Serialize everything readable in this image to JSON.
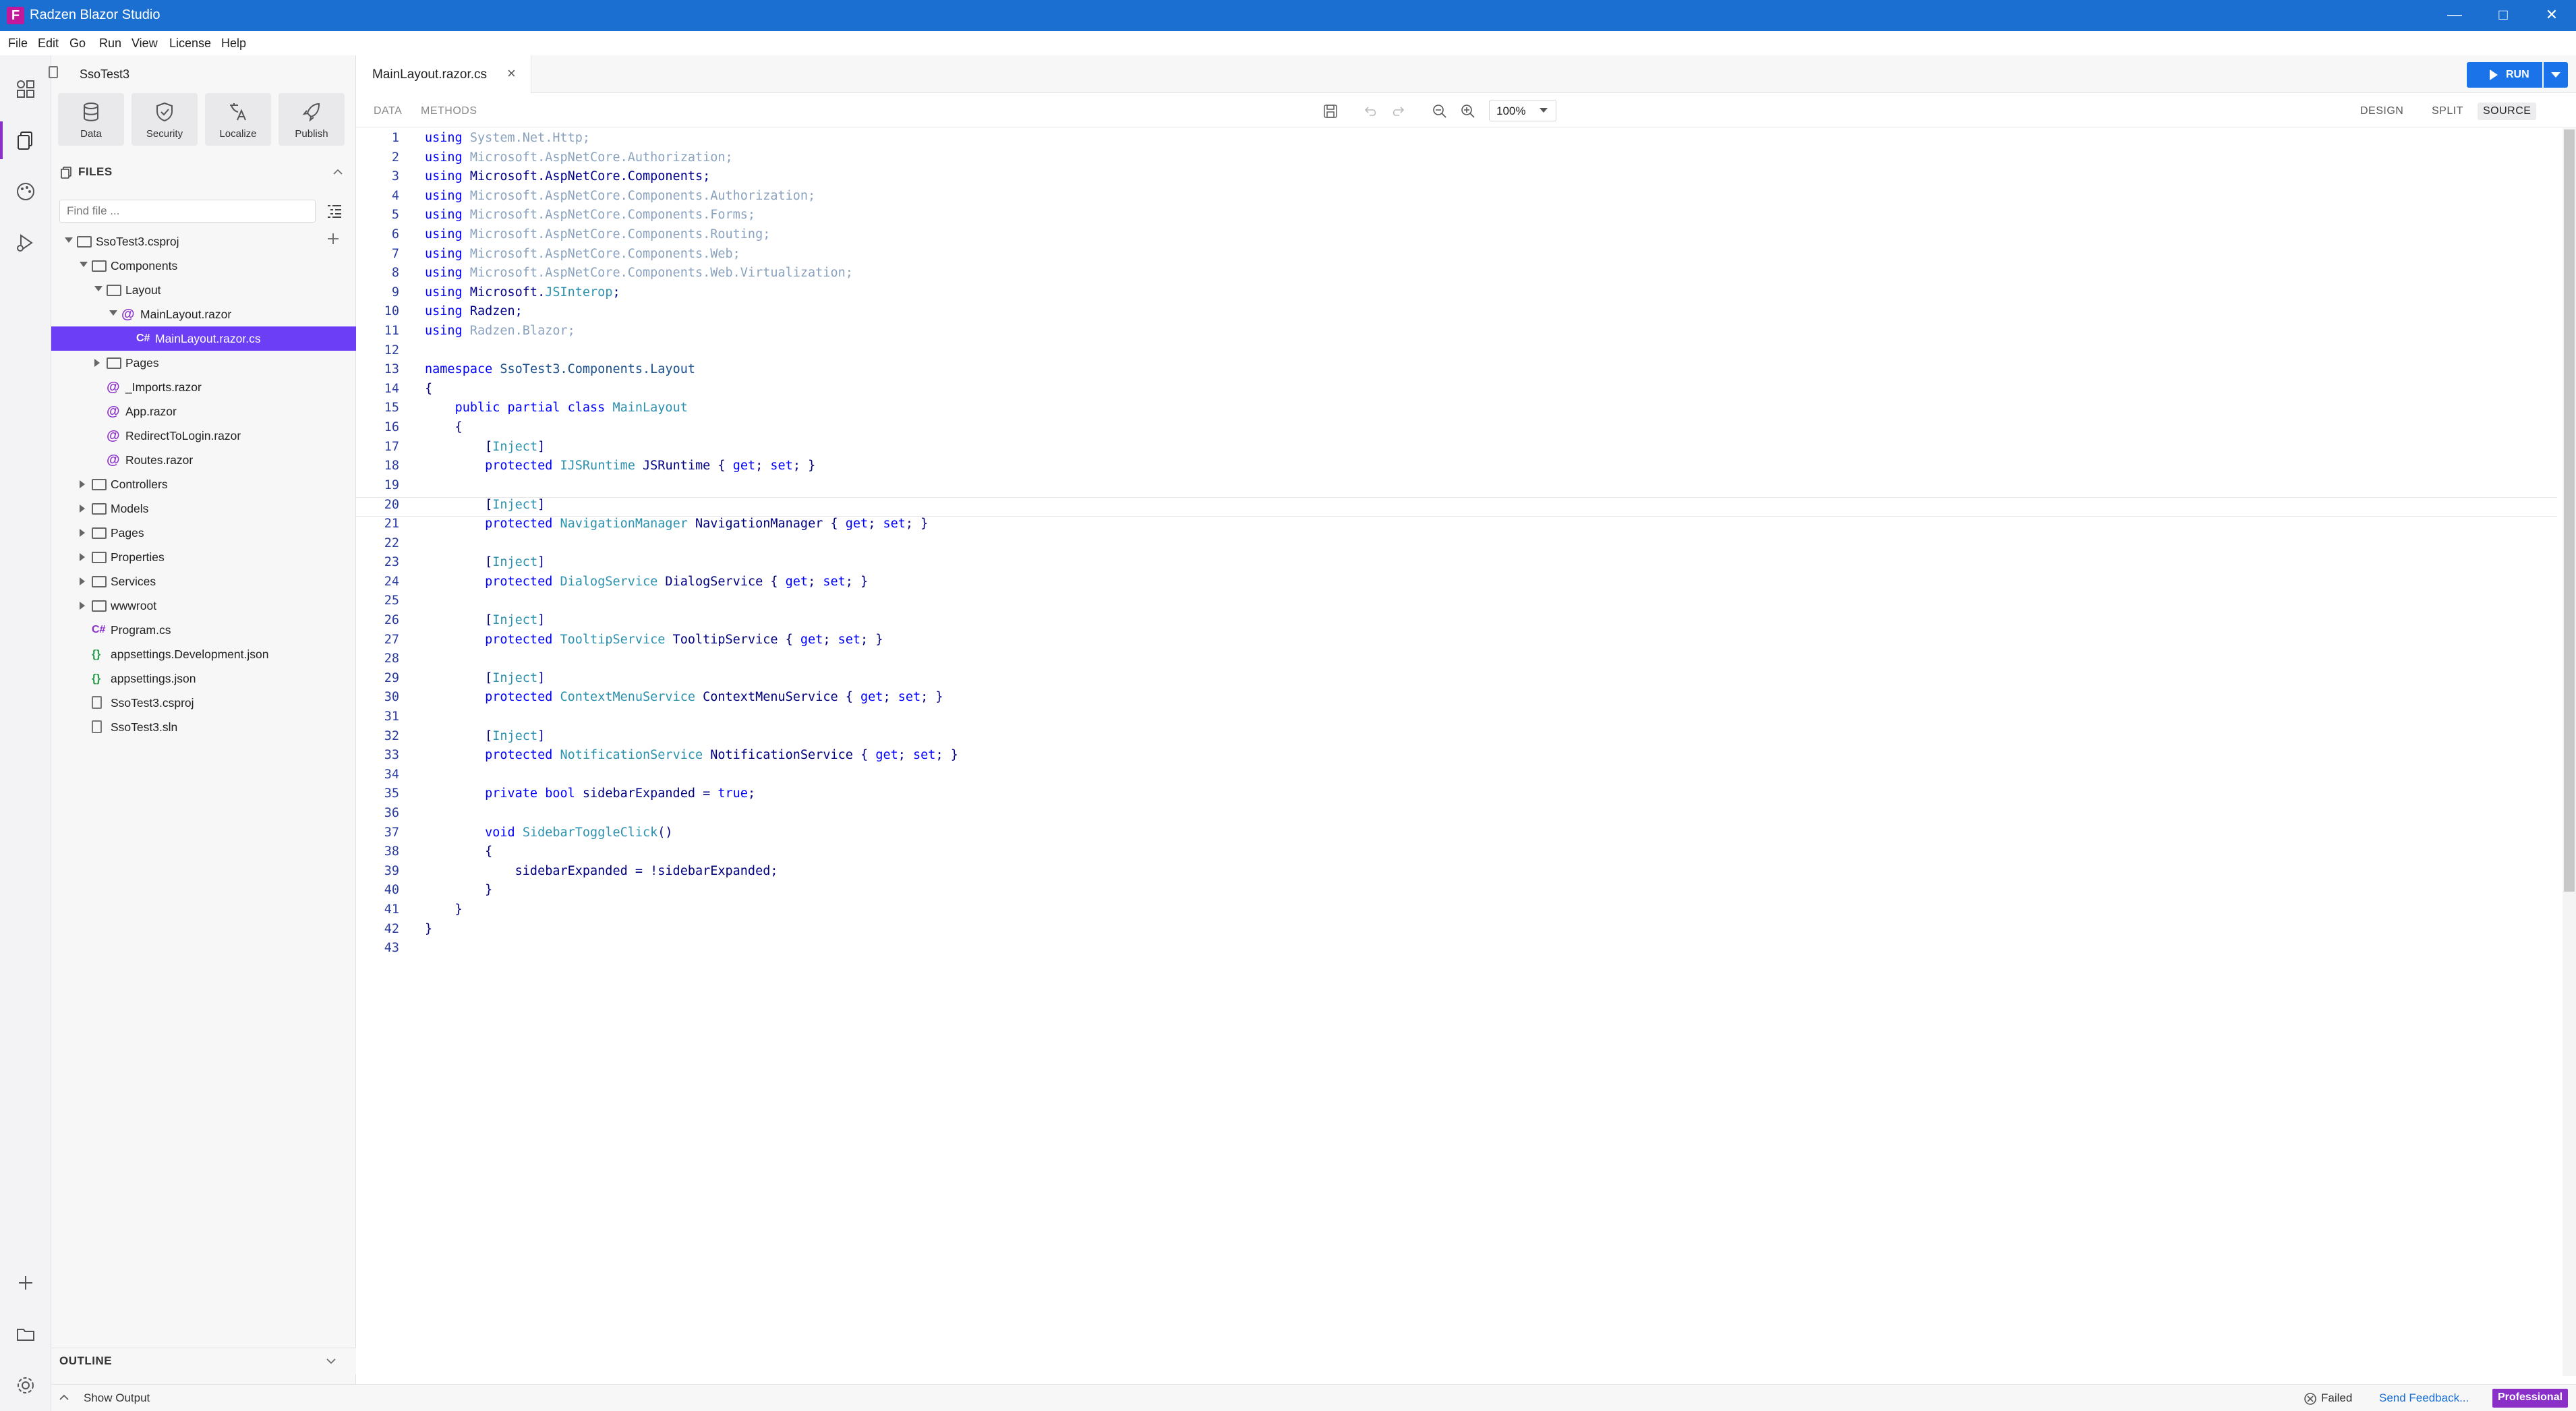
{
  "window": {
    "title": "Radzen Blazor Studio",
    "logo": "F"
  },
  "menu": [
    "File",
    "Edit",
    "Go",
    "Run",
    "View",
    "License",
    "Help"
  ],
  "activity_icons": [
    "components-icon",
    "files-icon",
    "theme-icon",
    "run-debug-icon",
    "add-icon",
    "folder-icon",
    "settings-icon"
  ],
  "sidebar": {
    "project": "SsoTest3",
    "tools": [
      {
        "label": "Data",
        "icon": "database-icon"
      },
      {
        "label": "Security",
        "icon": "shield-icon"
      },
      {
        "label": "Localize",
        "icon": "translate-icon"
      },
      {
        "label": "Publish",
        "icon": "rocket-icon"
      }
    ],
    "files_header": "FILES",
    "find_placeholder": "Find file ...",
    "tree": [
      {
        "name": "SsoTest3.csproj",
        "kind": "folder",
        "depth": 0,
        "arrow": "open"
      },
      {
        "name": "Components",
        "kind": "folder",
        "depth": 1,
        "arrow": "open"
      },
      {
        "name": "Layout",
        "kind": "folder",
        "depth": 2,
        "arrow": "open"
      },
      {
        "name": "MainLayout.razor",
        "kind": "razor",
        "depth": 3,
        "arrow": "open"
      },
      {
        "name": "MainLayout.razor.cs",
        "kind": "cs",
        "depth": 4,
        "arrow": "",
        "selected": true
      },
      {
        "name": "Pages",
        "kind": "folder",
        "depth": 2,
        "arrow": "closed"
      },
      {
        "name": "_Imports.razor",
        "kind": "razor",
        "depth": 2,
        "arrow": ""
      },
      {
        "name": "App.razor",
        "kind": "razor",
        "depth": 2,
        "arrow": ""
      },
      {
        "name": "RedirectToLogin.razor",
        "kind": "razor",
        "depth": 2,
        "arrow": ""
      },
      {
        "name": "Routes.razor",
        "kind": "razor",
        "depth": 2,
        "arrow": ""
      },
      {
        "name": "Controllers",
        "kind": "folder",
        "depth": 1,
        "arrow": "closed"
      },
      {
        "name": "Models",
        "kind": "folder",
        "depth": 1,
        "arrow": "closed"
      },
      {
        "name": "Pages",
        "kind": "folder",
        "depth": 1,
        "arrow": "closed"
      },
      {
        "name": "Properties",
        "kind": "folder",
        "depth": 1,
        "arrow": "closed"
      },
      {
        "name": "Services",
        "kind": "folder",
        "depth": 1,
        "arrow": "closed"
      },
      {
        "name": "wwwroot",
        "kind": "folder",
        "depth": 1,
        "arrow": "closed"
      },
      {
        "name": "Program.cs",
        "kind": "cs",
        "depth": 1,
        "arrow": ""
      },
      {
        "name": "appsettings.Development.json",
        "kind": "json",
        "depth": 1,
        "arrow": ""
      },
      {
        "name": "appsettings.json",
        "kind": "json",
        "depth": 1,
        "arrow": ""
      },
      {
        "name": "SsoTest3.csproj",
        "kind": "file",
        "depth": 1,
        "arrow": ""
      },
      {
        "name": "SsoTest3.sln",
        "kind": "file",
        "depth": 1,
        "arrow": ""
      }
    ],
    "outline_header": "OUTLINE"
  },
  "editor": {
    "tab_label": "MainLayout.razor.cs",
    "subtabs": [
      "DATA",
      "METHODS"
    ],
    "zoom": "100%",
    "views": [
      "DESIGN",
      "SPLIT",
      "SOURCE"
    ],
    "active_view": "SOURCE",
    "run_label": "RUN",
    "current_line": 20,
    "lines": [
      [
        [
          "kw",
          "using "
        ],
        [
          "dim",
          "System.Net.Http;"
        ]
      ],
      [
        [
          "kw",
          "using "
        ],
        [
          "dim",
          "Microsoft.AspNetCore.Authorization;"
        ]
      ],
      [
        [
          "kw",
          "using "
        ],
        [
          "kwd",
          "Microsoft.AspNetCore.Components;"
        ]
      ],
      [
        [
          "kw",
          "using "
        ],
        [
          "dim",
          "Microsoft.AspNetCore.Components.Authorization;"
        ]
      ],
      [
        [
          "kw",
          "using "
        ],
        [
          "dim",
          "Microsoft.AspNetCore.Components.Forms;"
        ]
      ],
      [
        [
          "kw",
          "using "
        ],
        [
          "dim",
          "Microsoft.AspNetCore.Components.Routing;"
        ]
      ],
      [
        [
          "kw",
          "using "
        ],
        [
          "dim",
          "Microsoft.AspNetCore.Components.Web;"
        ]
      ],
      [
        [
          "kw",
          "using "
        ],
        [
          "dim",
          "Microsoft.AspNetCore.Components.Web.Virtualization;"
        ]
      ],
      [
        [
          "kw",
          "using "
        ],
        [
          "kwd",
          "Microsoft."
        ],
        [
          "ty",
          "JSInterop"
        ],
        [
          "kwd",
          ";"
        ]
      ],
      [
        [
          "kw",
          "using "
        ],
        [
          "kwd",
          "Radzen;"
        ]
      ],
      [
        [
          "kw",
          "using "
        ],
        [
          "dim",
          "Radzen.Blazor;"
        ]
      ],
      [],
      [
        [
          "kw",
          "namespace "
        ],
        [
          "ns",
          "SsoTest3.Components.Layout"
        ]
      ],
      [
        [
          "tx",
          "{"
        ]
      ],
      [
        [
          "tx",
          "    "
        ],
        [
          "kw",
          "public partial class "
        ],
        [
          "ty",
          "MainLayout"
        ]
      ],
      [
        [
          "tx",
          "    {"
        ]
      ],
      [
        [
          "tx",
          "        ["
        ],
        [
          "ty",
          "Inject"
        ],
        [
          "tx",
          "]"
        ]
      ],
      [
        [
          "tx",
          "        "
        ],
        [
          "kw",
          "protected "
        ],
        [
          "ty",
          "IJSRuntime"
        ],
        [
          "tx",
          " JSRuntime { "
        ],
        [
          "kw",
          "get"
        ],
        [
          "tx",
          "; "
        ],
        [
          "kw",
          "set"
        ],
        [
          "tx",
          "; }"
        ]
      ],
      [],
      [
        [
          "tx",
          "        ["
        ],
        [
          "ty",
          "Inject"
        ],
        [
          "tx",
          "]"
        ]
      ],
      [
        [
          "tx",
          "        "
        ],
        [
          "kw",
          "protected "
        ],
        [
          "ty",
          "NavigationManager"
        ],
        [
          "tx",
          " NavigationManager { "
        ],
        [
          "kw",
          "get"
        ],
        [
          "tx",
          "; "
        ],
        [
          "kw",
          "set"
        ],
        [
          "tx",
          "; }"
        ]
      ],
      [],
      [
        [
          "tx",
          "        ["
        ],
        [
          "ty",
          "Inject"
        ],
        [
          "tx",
          "]"
        ]
      ],
      [
        [
          "tx",
          "        "
        ],
        [
          "kw",
          "protected "
        ],
        [
          "ty",
          "DialogService"
        ],
        [
          "tx",
          " DialogService { "
        ],
        [
          "kw",
          "get"
        ],
        [
          "tx",
          "; "
        ],
        [
          "kw",
          "set"
        ],
        [
          "tx",
          "; }"
        ]
      ],
      [],
      [
        [
          "tx",
          "        ["
        ],
        [
          "ty",
          "Inject"
        ],
        [
          "tx",
          "]"
        ]
      ],
      [
        [
          "tx",
          "        "
        ],
        [
          "kw",
          "protected "
        ],
        [
          "ty",
          "TooltipService"
        ],
        [
          "tx",
          " TooltipService { "
        ],
        [
          "kw",
          "get"
        ],
        [
          "tx",
          "; "
        ],
        [
          "kw",
          "set"
        ],
        [
          "tx",
          "; }"
        ]
      ],
      [],
      [
        [
          "tx",
          "        ["
        ],
        [
          "ty",
          "Inject"
        ],
        [
          "tx",
          "]"
        ]
      ],
      [
        [
          "tx",
          "        "
        ],
        [
          "kw",
          "protected "
        ],
        [
          "ty",
          "ContextMenuService"
        ],
        [
          "tx",
          " ContextMenuService { "
        ],
        [
          "kw",
          "get"
        ],
        [
          "tx",
          "; "
        ],
        [
          "kw",
          "set"
        ],
        [
          "tx",
          "; }"
        ]
      ],
      [],
      [
        [
          "tx",
          "        ["
        ],
        [
          "ty",
          "Inject"
        ],
        [
          "tx",
          "]"
        ]
      ],
      [
        [
          "tx",
          "        "
        ],
        [
          "kw",
          "protected "
        ],
        [
          "ty",
          "NotificationService"
        ],
        [
          "tx",
          " NotificationService { "
        ],
        [
          "kw",
          "get"
        ],
        [
          "tx",
          "; "
        ],
        [
          "kw",
          "set"
        ],
        [
          "tx",
          "; }"
        ]
      ],
      [],
      [
        [
          "tx",
          "        "
        ],
        [
          "kw",
          "private bool "
        ],
        [
          "tx",
          "sidebarExpanded = "
        ],
        [
          "kw",
          "true"
        ],
        [
          "tx",
          ";"
        ]
      ],
      [],
      [
        [
          "tx",
          "        "
        ],
        [
          "kw",
          "void "
        ],
        [
          "ty",
          "SidebarToggleClick"
        ],
        [
          "tx",
          "()"
        ]
      ],
      [
        [
          "tx",
          "        {"
        ]
      ],
      [
        [
          "tx",
          "            sidebarExpanded = !sidebarExpanded;"
        ]
      ],
      [
        [
          "tx",
          "        }"
        ]
      ],
      [
        [
          "tx",
          "    }"
        ]
      ],
      [
        [
          "tx",
          "}"
        ]
      ],
      []
    ]
  },
  "status": {
    "show_output": "Show Output",
    "failed": "Failed",
    "feedback": "Send Feedback...",
    "edition": "Professional"
  },
  "colors": {
    "titlebar": "#1a6fd1",
    "accent": "#8b2fc9",
    "selection": "#6c3ef5",
    "run": "#1a73e8",
    "edition_badge": "#8b2fc9"
  }
}
